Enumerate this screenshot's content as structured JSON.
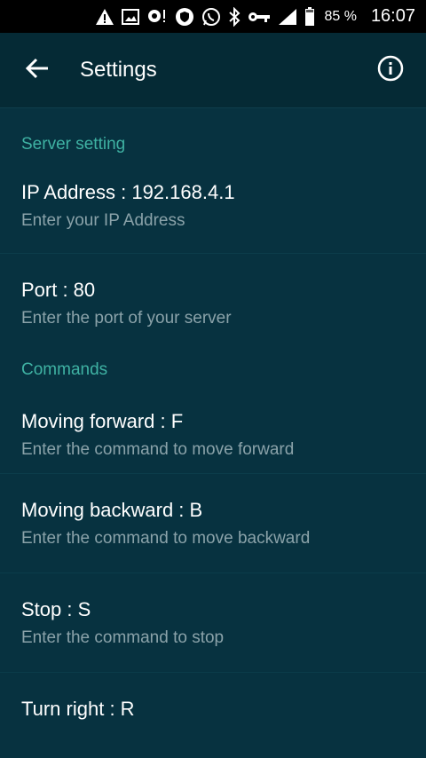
{
  "status_bar": {
    "battery": "85 %",
    "time": "16:07"
  },
  "toolbar": {
    "title": "Settings"
  },
  "sections": [
    {
      "header": "Server setting",
      "items": [
        {
          "title": "IP Address : 192.168.4.1",
          "summary": "Enter your IP Address"
        },
        {
          "title": "Port : 80",
          "summary": "Enter the port of your server"
        }
      ]
    },
    {
      "header": "Commands",
      "items": [
        {
          "title": "Moving forward : F",
          "summary": "Enter the command to move forward"
        },
        {
          "title": "Moving backward : B",
          "summary": "Enter the command to move backward"
        },
        {
          "title": "Stop : S",
          "summary": "Enter the command to stop"
        },
        {
          "title": "Turn right : R",
          "summary": ""
        }
      ]
    }
  ]
}
